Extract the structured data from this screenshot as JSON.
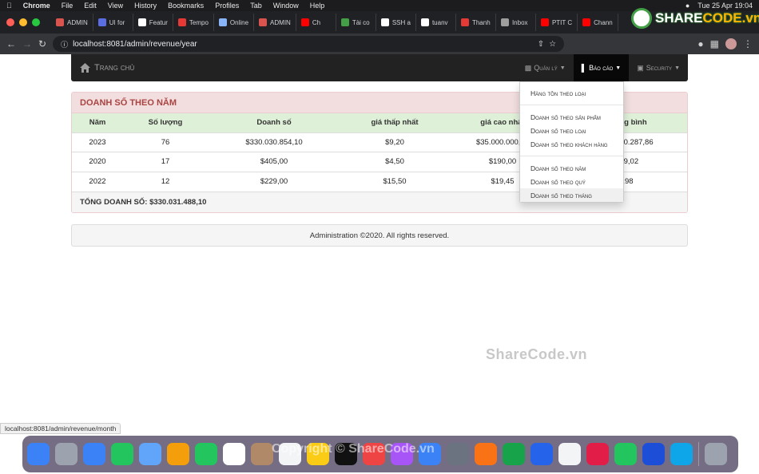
{
  "system_menu": {
    "app": "Chrome",
    "items": [
      "File",
      "Edit",
      "View",
      "History",
      "Bookmarks",
      "Profiles",
      "Tab",
      "Window",
      "Help"
    ],
    "clock": "Tue 25 Apr  19:04"
  },
  "tabs": [
    {
      "label": "ADMIN",
      "color": "#d9534f"
    },
    {
      "label": "UI for",
      "color": "#5b6ee1"
    },
    {
      "label": "Featur",
      "color": "#ffffff"
    },
    {
      "label": "Tempo",
      "color": "#e53935"
    },
    {
      "label": "Online",
      "color": "#8ab4f8"
    },
    {
      "label": "ADMIN",
      "color": "#d9534f"
    },
    {
      "label": "Ch",
      "color": "#ff0000"
    },
    {
      "label": "Tài co",
      "color": "#43a047"
    },
    {
      "label": "SSH a",
      "color": "#ffffff"
    },
    {
      "label": "tuanv",
      "color": "#ffffff"
    },
    {
      "label": "Thanh",
      "color": "#e53935"
    },
    {
      "label": "Inbox",
      "color": "#9e9e9e"
    },
    {
      "label": "PTIT C",
      "color": "#ff0000"
    },
    {
      "label": "Chann",
      "color": "#ff0000"
    }
  ],
  "address_bar": {
    "url": "localhost:8081/admin/revenue/year"
  },
  "navbar": {
    "brand": "Trang chủ",
    "menus": [
      {
        "label": "Quản lý",
        "icon": "briefcase-icon"
      },
      {
        "label": "Báo cáo",
        "icon": "bar-chart-icon",
        "open": true
      },
      {
        "label": "Security",
        "icon": "lock-icon"
      }
    ]
  },
  "dropdown": {
    "group1": [
      "Hàng tồn theo loại"
    ],
    "group2": [
      "Doanh số theo sản phẩm",
      "Doanh số theo loại",
      "Doanh số theo khách hàng"
    ],
    "group3": [
      "Doanh số theo năm",
      "Doanh số theo quý",
      "Doanh số theo tháng"
    ]
  },
  "panel": {
    "title": "DOANH SỐ THEO NĂM",
    "columns": [
      "Năm",
      "Số lượng",
      "Doanh số",
      "giá thấp nhất",
      "giá cao nhất",
      "giá trung bình"
    ],
    "rows": [
      [
        "2023",
        "76",
        "$330.030.854,10",
        "$9,20",
        "$35.000.000,00",
        "$4.342.510.287,86"
      ],
      [
        "2020",
        "17",
        "$405,00",
        "$4,50",
        "$190,00",
        "$23,89,02"
      ],
      [
        "2022",
        "12",
        "$229,00",
        "$15,50",
        "$19,45",
        "$17,98"
      ]
    ],
    "total": "TỔNG DOANH SỐ: $330.031.488,10"
  },
  "footer": {
    "text": "Administration ©2020. All rights reserved."
  },
  "status_bar": {
    "hover_url": "localhost:8081/admin/revenue/month"
  },
  "watermarks": {
    "center": "ShareCode.vn",
    "dock": "Copyright © ShareCode.vn",
    "logo_share": "SHARE",
    "logo_code": "CODE.vn"
  },
  "dock_apps": [
    {
      "name": "finder",
      "color": "#3b82f6"
    },
    {
      "name": "launchpad",
      "color": "#9ca3af"
    },
    {
      "name": "safari",
      "color": "#3b82f6"
    },
    {
      "name": "messages",
      "color": "#22c55e"
    },
    {
      "name": "mail",
      "color": "#60a5fa"
    },
    {
      "name": "photos",
      "color": "#f59e0b"
    },
    {
      "name": "facetime",
      "color": "#22c55e"
    },
    {
      "name": "calendar",
      "color": "#ffffff"
    },
    {
      "name": "contacts",
      "color": "#b08968"
    },
    {
      "name": "reminders",
      "color": "#f3f4f6"
    },
    {
      "name": "notes",
      "color": "#facc15"
    },
    {
      "name": "tv",
      "color": "#111111"
    },
    {
      "name": "music",
      "color": "#ef4444"
    },
    {
      "name": "podcasts",
      "color": "#a855f7"
    },
    {
      "name": "app-store",
      "color": "#3b82f6"
    },
    {
      "name": "settings",
      "color": "#6b7280"
    },
    {
      "name": "pages",
      "color": "#f97316"
    },
    {
      "name": "excel",
      "color": "#16a34a"
    },
    {
      "name": "zalo",
      "color": "#2563eb"
    },
    {
      "name": "chrome",
      "color": "#f3f4f6"
    },
    {
      "name": "intellij",
      "color": "#e11d48"
    },
    {
      "name": "datagrip",
      "color": "#22c55e"
    },
    {
      "name": "maps",
      "color": "#1d4ed8"
    },
    {
      "name": "docker",
      "color": "#0ea5e9"
    },
    {
      "name": "trash",
      "color": "#9ca3af"
    }
  ]
}
